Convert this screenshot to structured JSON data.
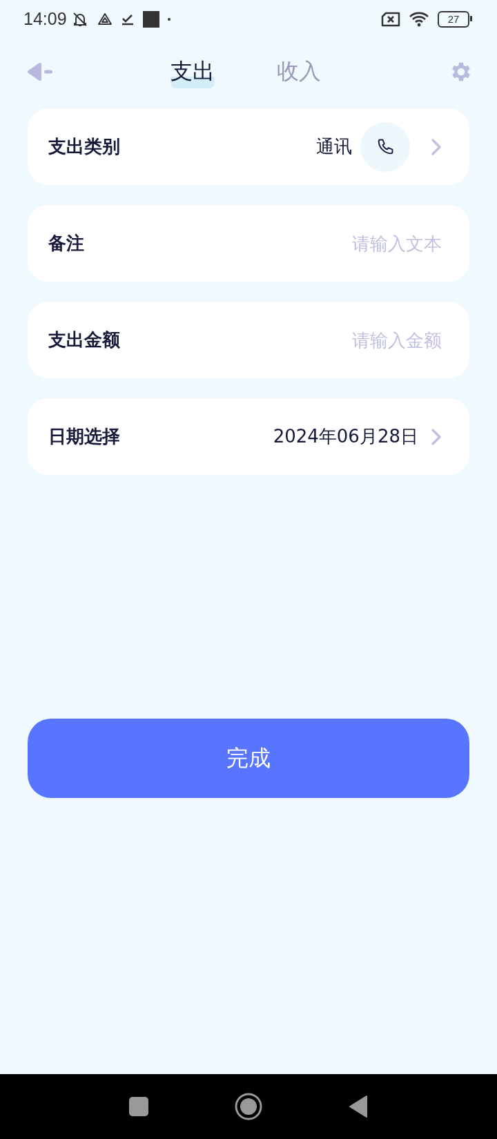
{
  "status_bar": {
    "time": "14:09",
    "battery": "27"
  },
  "tabs": [
    {
      "label": "支出",
      "selected": true
    },
    {
      "label": "收入",
      "selected": false
    }
  ],
  "fields": [
    {
      "kind": "category",
      "label": "支出类别",
      "value": "通讯"
    },
    {
      "kind": "input",
      "label": "备注",
      "placeholder": "请输入文本"
    },
    {
      "kind": "input",
      "label": "支出金额",
      "placeholder": "请输入金额"
    },
    {
      "kind": "date",
      "label": "日期选择",
      "value": "2024年06月28日"
    }
  ],
  "submit_button": "完成"
}
